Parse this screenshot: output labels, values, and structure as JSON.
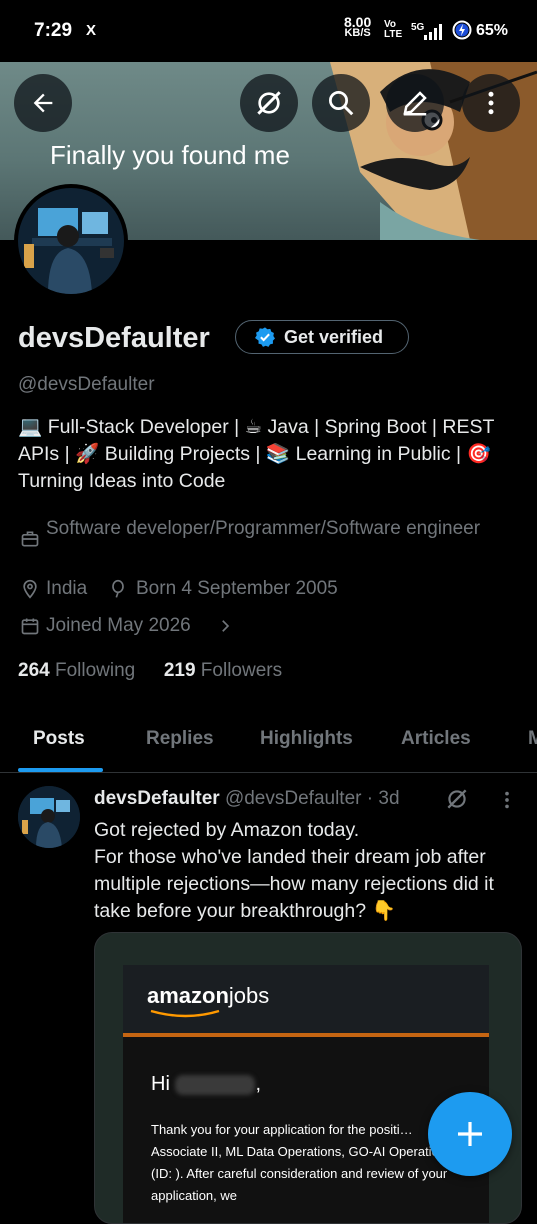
{
  "status_bar": {
    "time": "7:29",
    "x_icon": "X",
    "net_speed": "8.00",
    "net_unit": "KB/S",
    "volte_top": "Vo",
    "volte_bottom": "LTE",
    "signal_5g": "5G",
    "battery": "65%"
  },
  "banner": {
    "caption": "Finally you found me"
  },
  "header_icons": [
    "back-arrow-icon",
    "grok-icon",
    "search-icon",
    "edit-icon",
    "more-vertical-icon"
  ],
  "profile": {
    "name": "devsDefaulter",
    "verify_label": "Get verified",
    "handle": "@devsDefaulter",
    "bio": "💻 Full-Stack Developer | ☕ Java | Spring Boot | REST APIs | 🚀 Building Projects | 📚 Learning in Public | 🎯 Turning Ideas into Code",
    "profession": "Software developer/Programmer/Software engineer",
    "location": "India",
    "birthday": "Born 4 September 2005",
    "joined": "Joined May 2026",
    "following_count": "264",
    "following_label": "Following",
    "followers_count": "219",
    "followers_label": "Followers"
  },
  "tabs": [
    {
      "label": "Posts",
      "active": true
    },
    {
      "label": "Replies"
    },
    {
      "label": "Highlights"
    },
    {
      "label": "Articles"
    },
    {
      "label": "M"
    }
  ],
  "post": {
    "author": "devsDefaulter",
    "handle": "@devsDefaulter",
    "time": "· 3d",
    "line1": "Got rejected by Amazon today.",
    "line2": "For those who've landed their dream job after multiple rejections—how many rejections did it take before your breakthrough? 👇",
    "media": {
      "brand_left": "amazon",
      "brand_right": "jobs",
      "greeting": "Hi",
      "greeting_end": ",",
      "body": "Thank you for your application for the positi… Associate II, ML Data Operations, GO-AI Operations (ID: ). After careful consideration and review of your application, we"
    }
  },
  "colors": {
    "accent": "#1d9bf0",
    "muted": "#71767b",
    "text": "#e7e9ea",
    "amazon_orange": "#c56512"
  }
}
